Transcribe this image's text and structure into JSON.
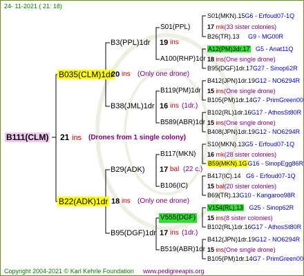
{
  "header": {
    "timestamp": "24- 11-2021 ( 21: 18)"
  },
  "footer": {
    "copyright": "Copyright 2004-2021 © Karl Kehrle Foundation",
    "site": "www.pedigreeapis.org"
  },
  "root": {
    "id": "B111(CLM)",
    "count": "21",
    "ins": "ins",
    "note": "(Drones from 1 single colony)"
  },
  "gen1": {
    "top": {
      "id": "B035(CLM)1dr",
      "count": "20",
      "ins": "ins",
      "note": "(Only one drone)"
    },
    "bottom": {
      "id": "B22(ADK)1dr",
      "count": "18",
      "ins": "ins",
      "note": "(Only one drone)"
    }
  },
  "gen2": {
    "a": {
      "id": "B3(PPL)1dr",
      "count": "19",
      "ins": "ins"
    },
    "b": {
      "id": "B38(JML)1dr",
      "count": "16",
      "ins": "ins",
      "note": "(1dr.)"
    },
    "c": {
      "id": "B29(ADK)",
      "count": "17",
      "ins": "bal",
      "note": "(22 c.)"
    },
    "d": {
      "id": "B95(DGF)1dr",
      "count": "17",
      "ins": "ins",
      "note": "(1dr.)"
    }
  },
  "gen3": {
    "a1": {
      "id": "S01(PPL)"
    },
    "a2": {
      "id": "A100(RHP)1dr"
    },
    "b1": {
      "id": "B119(PM)1dr"
    },
    "b2": {
      "id": "B589(ABR)1dr"
    },
    "c1": {
      "id": "B117(MKN)"
    },
    "c2": {
      "id": "B106(IC)"
    },
    "d1": {
      "id": "V555(DGF)"
    },
    "d2": {
      "id": "B519(ABR)1dr"
    }
  },
  "gen4": [
    {
      "main": "S01(MKN).15",
      "tail": "G6 - Erfoud07-1Q"
    },
    {
      "count": "17",
      "ins": "mk",
      "note": "(33 sister colonies)"
    },
    {
      "main": "B26(TR).13",
      "tail": "G9 - MG00R"
    },
    {
      "main": "A12(PM)3dr.17",
      "tail": "G5 - Anat11Q"
    },
    {
      "count": "18",
      "ins": "ins",
      "note": "(One single drone)"
    },
    {
      "main": "B95(DGF)1dr.17",
      "tail": "G27 - Sinop62R"
    },
    {
      "main": "B412(JPN)1dr.19",
      "tail": "G12 - NO6294R"
    },
    {
      "count": "15",
      "ins": "ins",
      "note": "(One single drone)"
    },
    {
      "main": "B105(PM)1dr.14",
      "tail": "G7 - PrimGreen00"
    },
    {
      "main": "B102(RL)1dr.16",
      "tail": "G17 - AthosSt80R"
    },
    {
      "count": "15",
      "ins": "ins",
      "note": "(One single drone)"
    },
    {
      "main": "B408(JPN)1dr.19",
      "tail": "G12 - NO6294R"
    },
    {
      "main": "S10(MKN).13",
      "tail": "G5 - Erfoud07-1Q"
    },
    {
      "count": "16",
      "ins": "mk",
      "note": "(28 sister colonies)"
    },
    {
      "main": "B59(MKN).1G",
      "tail": "G16 - SinopEgg86R"
    },
    {
      "main": "B417(IC).14",
      "tail": "G6 - Erfoud07-1Q"
    },
    {
      "count": "15",
      "ins": "bal",
      "note": "(20 sister colonies)"
    },
    {
      "main": "B69(TR).13",
      "tail": "G10 - Kangaroo98R"
    },
    {
      "main": "V154(RL).13",
      "tail": "G25 - Sinop62R"
    },
    {
      "count": "15",
      "ins": "ins",
      "note": "(8 sister colonies)"
    },
    {
      "main": "B102(RL)1dr.16",
      "tail": "G17 - AthosSt80R"
    },
    {
      "main": "B412(JPN)1dr.19",
      "tail": "G12 - NO6294R"
    },
    {
      "count": "15",
      "ins": "ins",
      "note": "(One single drone)"
    },
    {
      "main": "B105(PM)1dr.14",
      "tail": "G7 - PrimGreen00"
    }
  ]
}
